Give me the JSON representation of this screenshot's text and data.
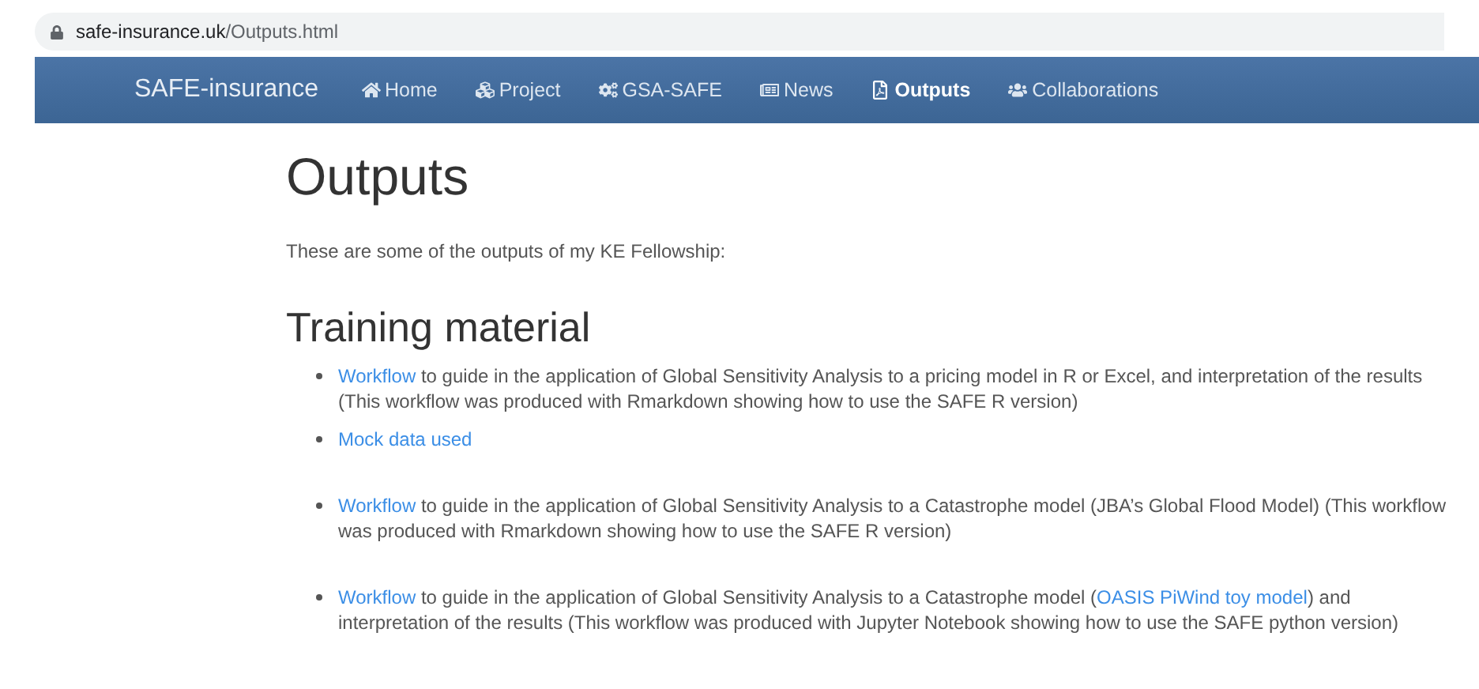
{
  "address_bar": {
    "domain": "safe-insurance.uk",
    "path": "/Outputs.html"
  },
  "navbar": {
    "brand": "SAFE-insurance",
    "items": [
      {
        "label": "Home",
        "selected": false
      },
      {
        "label": "Project",
        "selected": false
      },
      {
        "label": "GSA-SAFE",
        "selected": false
      },
      {
        "label": "News",
        "selected": false
      },
      {
        "label": "Outputs",
        "selected": true
      },
      {
        "label": "Collaborations",
        "selected": false
      }
    ]
  },
  "page": {
    "title": "Outputs",
    "intro": "These are some of the outputs of my KE Fellowship:",
    "sections": [
      {
        "heading": "Training material",
        "groups": [
          [
            {
              "parts": [
                {
                  "kind": "link",
                  "text": "Workflow"
                },
                {
                  "kind": "text",
                  "text": " to guide in the application of Global Sensitivity Analysis to a pricing model in R or Excel, and interpretation of the results (This workflow was produced with Rmarkdown showing how to use the SAFE R version)"
                }
              ]
            },
            {
              "parts": [
                {
                  "kind": "link",
                  "text": "Mock data used"
                }
              ]
            }
          ],
          [
            {
              "parts": [
                {
                  "kind": "link",
                  "text": "Workflow"
                },
                {
                  "kind": "text",
                  "text": " to guide in the application of Global Sensitivity Analysis to a Catastrophe model (JBA’s Global Flood Model) (This workflow was produced with Rmarkdown showing how to use the SAFE R version)"
                }
              ]
            }
          ],
          [
            {
              "parts": [
                {
                  "kind": "link",
                  "text": "Workflow"
                },
                {
                  "kind": "text",
                  "text": " to guide in the application of Global Sensitivity Analysis to a Catastrophe model ("
                },
                {
                  "kind": "link",
                  "text": "OASIS PiWind toy model"
                },
                {
                  "kind": "text",
                  "text": ") and interpretation of the results (This workflow was produced with Jupyter Notebook showing how to use the SAFE python version)"
                }
              ]
            }
          ]
        ]
      }
    ]
  }
}
